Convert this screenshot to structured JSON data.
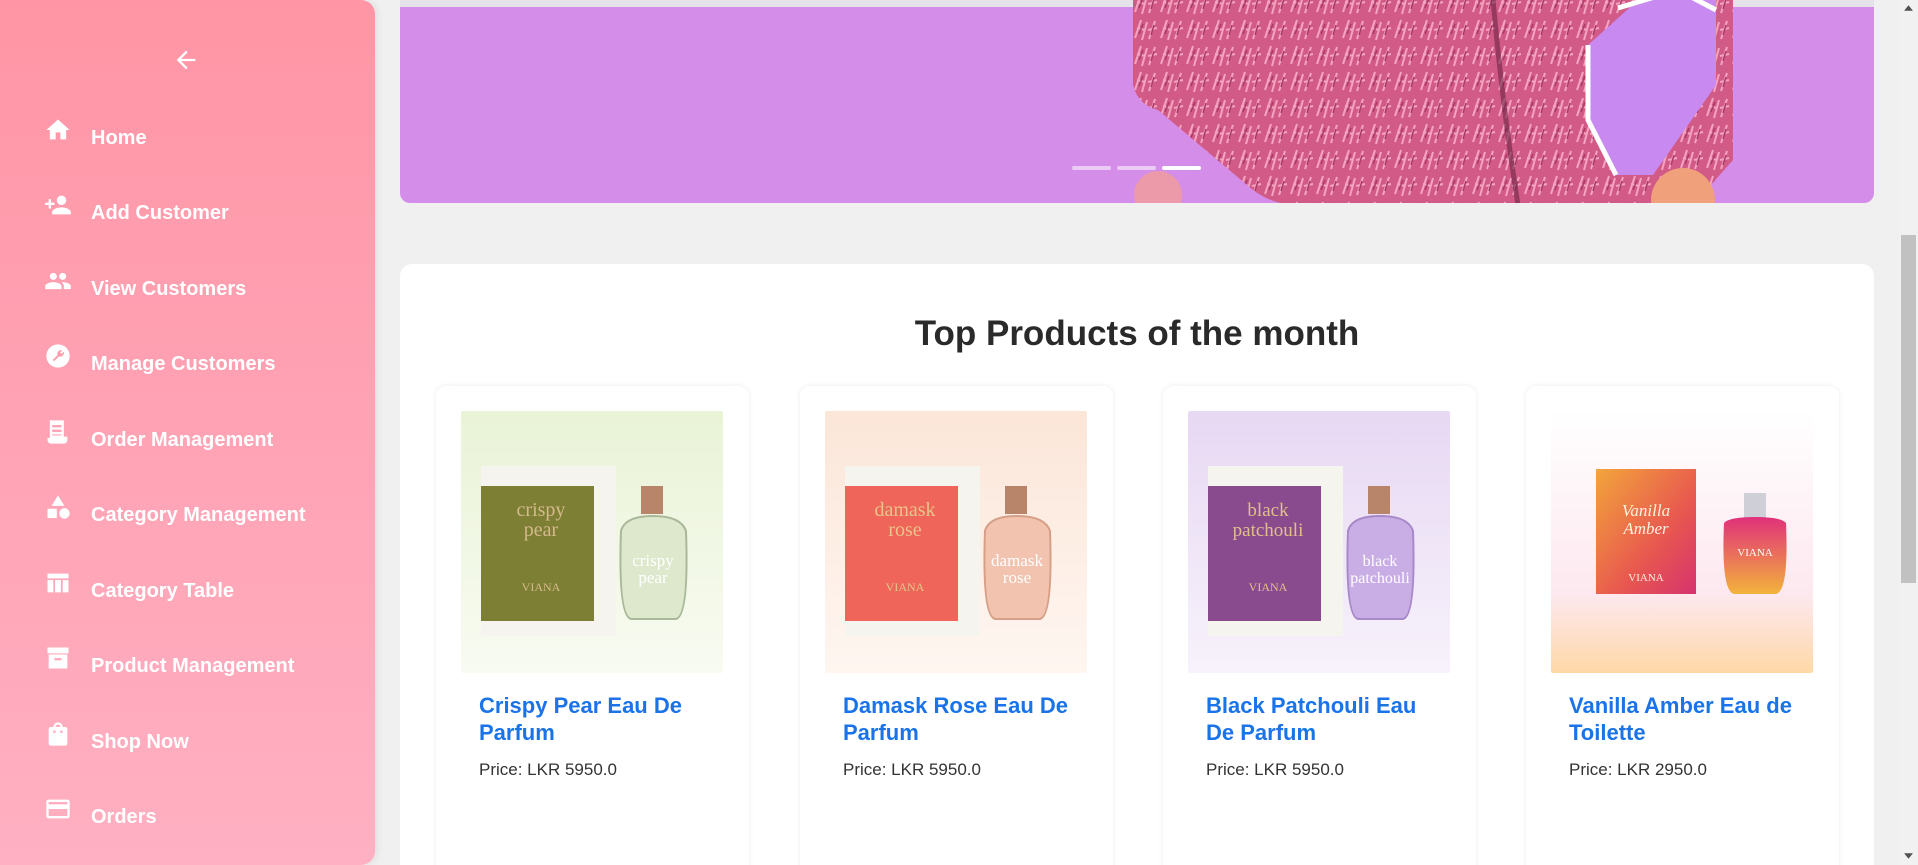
{
  "sidebar": {
    "back_icon": "arrow-left-icon",
    "items": [
      {
        "label": "Home",
        "icon": "home-icon"
      },
      {
        "label": "Add Customer",
        "icon": "person-add-icon"
      },
      {
        "label": "View Customers",
        "icon": "people-icon"
      },
      {
        "label": "Manage Customers",
        "icon": "wrench-icon"
      },
      {
        "label": "Order Management",
        "icon": "receipt-icon"
      },
      {
        "label": "Category Management",
        "icon": "shapes-icon"
      },
      {
        "label": "Category Table",
        "icon": "table-icon"
      },
      {
        "label": "Product Management",
        "icon": "archive-icon"
      },
      {
        "label": "Shop Now",
        "icon": "shopping-bag-icon"
      },
      {
        "label": "Orders",
        "icon": "credit-card-icon"
      }
    ]
  },
  "banner": {
    "slides": 3,
    "active_slide": 3
  },
  "top_products": {
    "title": "Top Products of the month",
    "products": [
      {
        "name": "Crispy Pear Eau De Parfum",
        "price": "Price: LKR 5950.0",
        "box_text": "crispy pear",
        "brand": "VIANA",
        "theme": "#7d7f35"
      },
      {
        "name": "Damask Rose Eau De Parfum",
        "price": "Price: LKR 5950.0",
        "box_text": "damask rose",
        "brand": "VIANA",
        "theme": "#f0655a"
      },
      {
        "name": "Black Patchouli Eau De Parfum",
        "price": "Price: LKR 5950.0",
        "box_text": "black patchouli",
        "brand": "VIANA",
        "theme": "#8a4a8e"
      },
      {
        "name": "Vanilla Amber Eau de Toilette",
        "price": "Price: LKR 2950.0",
        "box_text": "Vanilla Amber",
        "brand": "VIANA",
        "theme": "#e8a23a"
      }
    ]
  },
  "colors": {
    "sidebar": "#ff9aab",
    "banner": "#d48de9",
    "link": "#1a73e8"
  }
}
